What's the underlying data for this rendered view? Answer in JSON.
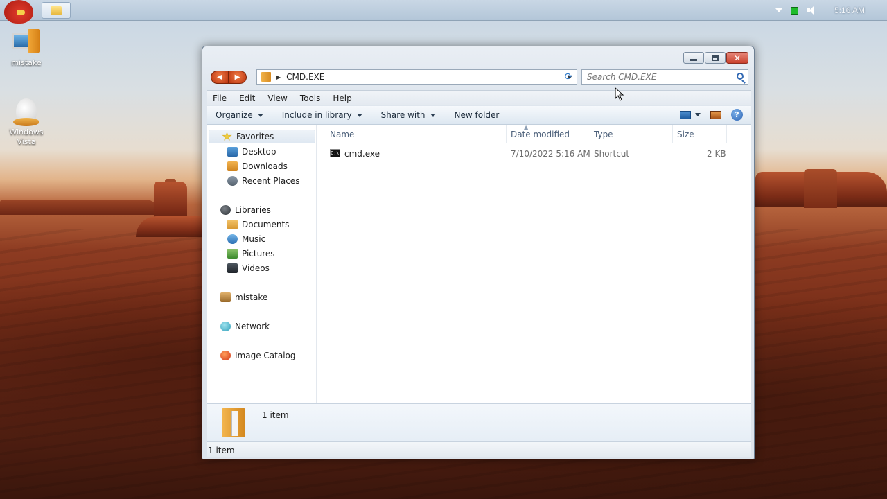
{
  "taskbar": {
    "time": "5:16 AM"
  },
  "desktop": {
    "icons": [
      {
        "label": "mistake"
      },
      {
        "label": "Windows Vista"
      }
    ]
  },
  "window": {
    "address": {
      "path": "CMD.EXE"
    },
    "search": {
      "placeholder": "Search CMD.EXE"
    },
    "menu": [
      "File",
      "Edit",
      "View",
      "Tools",
      "Help"
    ],
    "commands": {
      "organize": "Organize",
      "include_in_library": "Include in library",
      "share_with": "Share with",
      "new_folder": "New folder"
    },
    "nav": {
      "favorites": "Favorites",
      "desktop": "Desktop",
      "downloads": "Downloads",
      "recent_places": "Recent Places",
      "libraries": "Libraries",
      "documents": "Documents",
      "music": "Music",
      "pictures": "Pictures",
      "videos": "Videos",
      "user": "mistake",
      "network": "Network",
      "image_catalog": "Image Catalog"
    },
    "columns": {
      "name": "Name",
      "date_modified": "Date modified",
      "type": "Type",
      "size": "Size"
    },
    "files": [
      {
        "name": "cmd.exe",
        "date_modified": "7/10/2022 5:16 AM",
        "type": "Shortcut",
        "size": "2 KB",
        "icon_text": "C:\\"
      }
    ],
    "details": {
      "count": "1 item"
    },
    "status": {
      "count": "1 item"
    }
  }
}
